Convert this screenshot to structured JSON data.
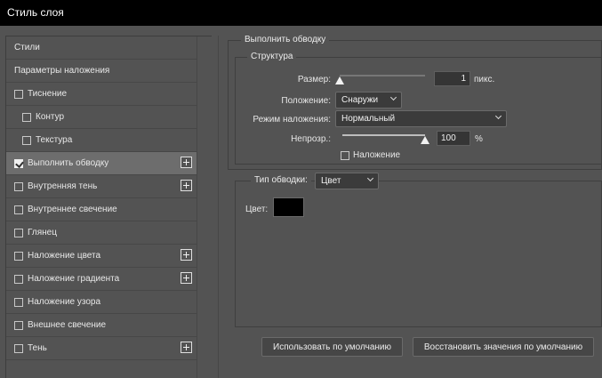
{
  "window": {
    "title": "Стиль слоя"
  },
  "sidebar": {
    "items": [
      {
        "label": "Стили",
        "checkbox": false,
        "checked": false,
        "plus": false,
        "selected": false,
        "indent": false
      },
      {
        "label": "Параметры наложения",
        "checkbox": false,
        "checked": false,
        "plus": false,
        "selected": false,
        "indent": false
      },
      {
        "label": "Тиснение",
        "checkbox": true,
        "checked": false,
        "plus": false,
        "selected": false,
        "indent": false
      },
      {
        "label": "Контур",
        "checkbox": true,
        "checked": false,
        "plus": false,
        "selected": false,
        "indent": true
      },
      {
        "label": "Текстура",
        "checkbox": true,
        "checked": false,
        "plus": false,
        "selected": false,
        "indent": true
      },
      {
        "label": "Выполнить обводку",
        "checkbox": true,
        "checked": true,
        "plus": true,
        "selected": true,
        "indent": false
      },
      {
        "label": "Внутренняя тень",
        "checkbox": true,
        "checked": false,
        "plus": true,
        "selected": false,
        "indent": false
      },
      {
        "label": "Внутреннее свечение",
        "checkbox": true,
        "checked": false,
        "plus": false,
        "selected": false,
        "indent": false
      },
      {
        "label": "Глянец",
        "checkbox": true,
        "checked": false,
        "plus": false,
        "selected": false,
        "indent": false
      },
      {
        "label": "Наложение цвета",
        "checkbox": true,
        "checked": false,
        "plus": true,
        "selected": false,
        "indent": false
      },
      {
        "label": "Наложение градиента",
        "checkbox": true,
        "checked": false,
        "plus": true,
        "selected": false,
        "indent": false
      },
      {
        "label": "Наложение узора",
        "checkbox": true,
        "checked": false,
        "plus": false,
        "selected": false,
        "indent": false
      },
      {
        "label": "Внешнее свечение",
        "checkbox": true,
        "checked": false,
        "plus": false,
        "selected": false,
        "indent": false
      },
      {
        "label": "Тень",
        "checkbox": true,
        "checked": false,
        "plus": true,
        "selected": false,
        "indent": false
      }
    ]
  },
  "stroke": {
    "section_title": "Выполнить обводку",
    "structure": {
      "title": "Структура",
      "size_label": "Размер:",
      "size_value": "1",
      "size_unit": "пикс.",
      "size_slider_fraction": 0.0,
      "position_label": "Положение:",
      "position_value": "Снаружи",
      "blend_label": "Режим наложения:",
      "blend_value": "Нормальный",
      "opacity_label": "Непрозр.:",
      "opacity_value": "100",
      "opacity_unit": "%",
      "opacity_slider_fraction": 1.0,
      "overprint_label": "Наложение",
      "overprint_checked": false
    },
    "fill": {
      "type_label": "Тип обводки:",
      "type_value": "Цвет",
      "color_label": "Цвет:",
      "color_value": "#000000"
    }
  },
  "buttons": {
    "make_default": "Использовать по умолчанию",
    "reset_default": "Восстановить значения по умолчанию"
  }
}
